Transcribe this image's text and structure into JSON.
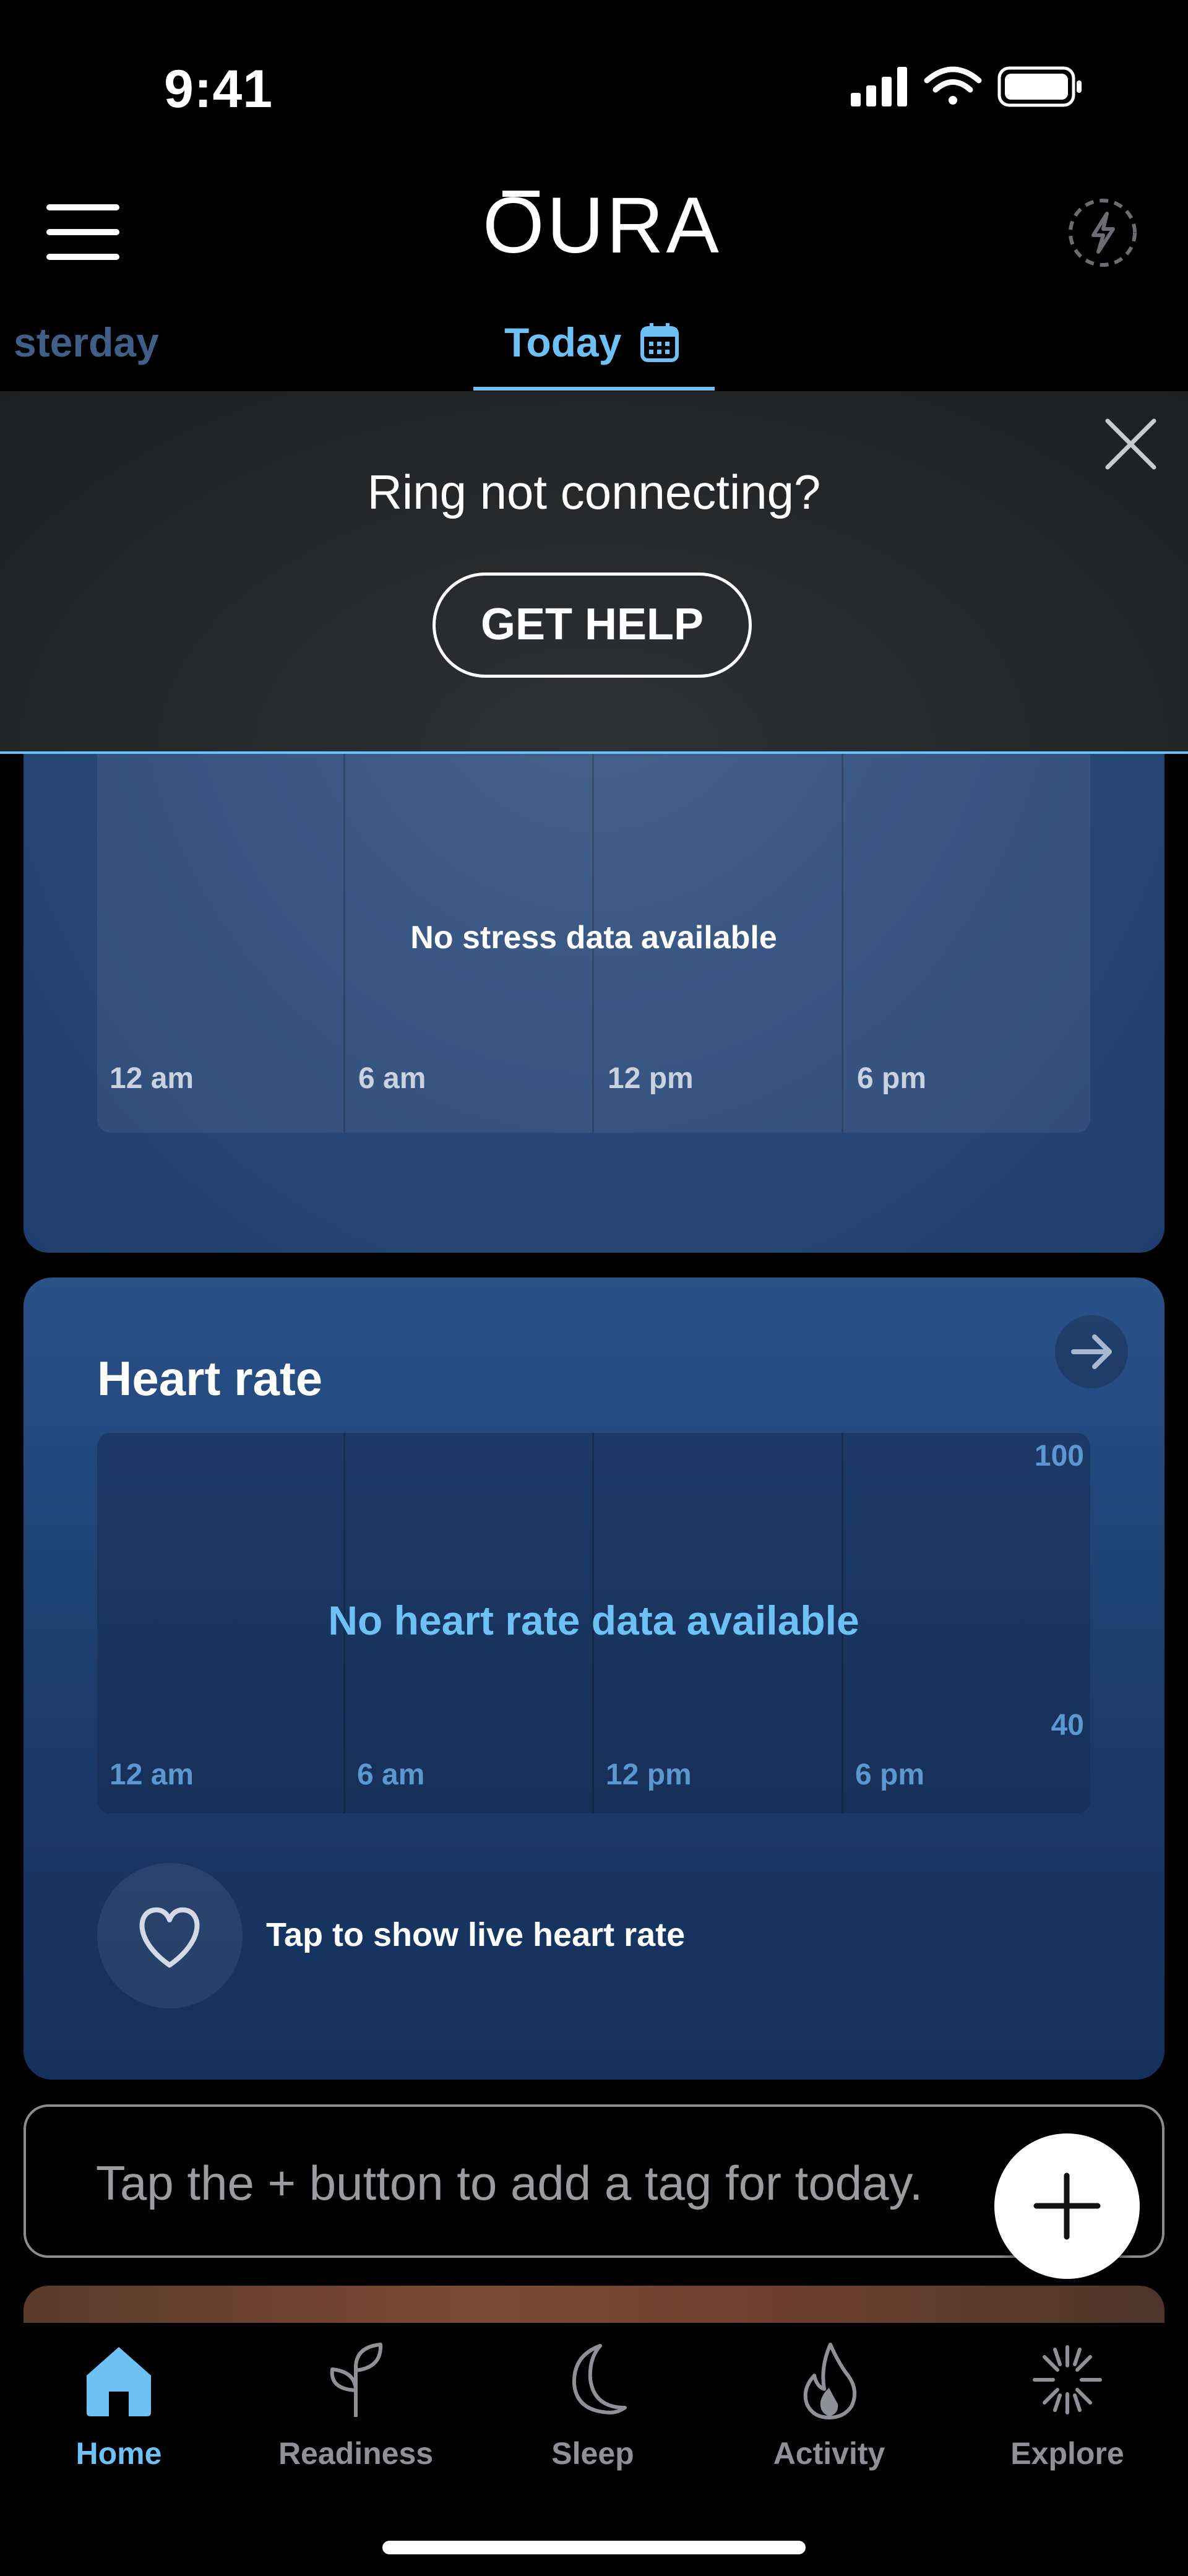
{
  "status_bar": {
    "time": "9:41"
  },
  "header": {
    "logo": "OURA"
  },
  "date_tabs": {
    "previous": "sterday",
    "current": "Today"
  },
  "banner": {
    "title": "Ring not connecting?",
    "button": "GET HELP"
  },
  "stress_card": {
    "message": "No stress data available",
    "ticks": [
      "12 am",
      "6 am",
      "12 pm",
      "6 pm"
    ]
  },
  "heart_rate_card": {
    "title": "Heart rate",
    "message": "No heart rate data available",
    "ticks": [
      "12 am",
      "6 am",
      "12 pm",
      "6 pm"
    ],
    "y_max": "100",
    "y_min": "40",
    "live_label": "Tap to show live heart rate"
  },
  "tag_bar": {
    "placeholder": "Tap the + button to add a tag for today."
  },
  "bottom_nav": {
    "items": [
      {
        "label": "Home",
        "icon": "home-icon",
        "active": true
      },
      {
        "label": "Readiness",
        "icon": "sprout-icon",
        "active": false
      },
      {
        "label": "Sleep",
        "icon": "moon-icon",
        "active": false
      },
      {
        "label": "Activity",
        "icon": "flame-icon",
        "active": false
      },
      {
        "label": "Explore",
        "icon": "sparkle-icon",
        "active": false
      }
    ]
  },
  "colors": {
    "accent": "#6ec1f5",
    "inactive": "#8f9196",
    "card_blue": "#1d3f70"
  }
}
